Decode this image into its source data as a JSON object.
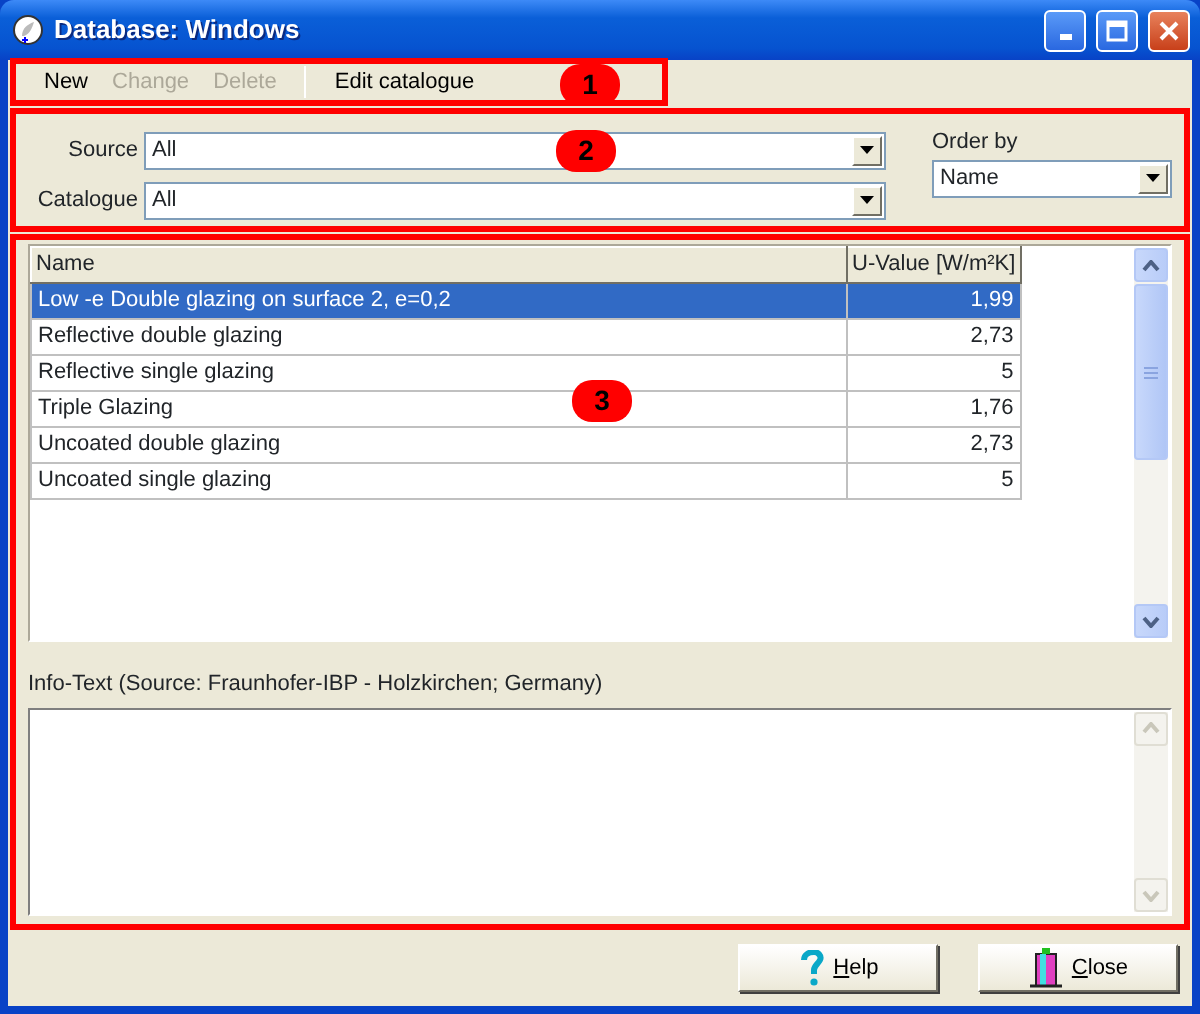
{
  "window": {
    "title": "Database: Windows"
  },
  "toolbar": {
    "callout": "1",
    "items": [
      {
        "kind": "button",
        "label": "New",
        "disabled": false
      },
      {
        "kind": "button",
        "label": "Change",
        "disabled": true
      },
      {
        "kind": "button",
        "label": "Delete",
        "disabled": true
      },
      {
        "kind": "separator"
      },
      {
        "kind": "button",
        "label": "Edit catalogue",
        "disabled": false
      }
    ]
  },
  "filters": {
    "callout": "2",
    "source": {
      "label": "Source",
      "value": "All"
    },
    "catalogue": {
      "label": "Catalogue",
      "value": "All"
    },
    "order_by": {
      "label": "Order by",
      "value": "Name"
    }
  },
  "table": {
    "callout": "3",
    "columns": [
      "Name",
      "U-Value [W/m²K]"
    ],
    "rows": [
      {
        "cells": [
          "Low -e Double glazing on surface 2, e=0,2",
          "1,99"
        ],
        "selected": true
      },
      {
        "cells": [
          "Reflective double glazing",
          "2,73"
        ],
        "selected": false
      },
      {
        "cells": [
          "Reflective single glazing",
          "5"
        ],
        "selected": false
      },
      {
        "cells": [
          "Triple Glazing",
          "1,76"
        ],
        "selected": false
      },
      {
        "cells": [
          "Uncoated double glazing",
          "2,73"
        ],
        "selected": false
      },
      {
        "cells": [
          "Uncoated single glazing",
          "5"
        ],
        "selected": false
      }
    ]
  },
  "info": {
    "label": "Info-Text  (Source: Fraunhofer-IBP - Holzkirchen; Germany)"
  },
  "buttons": [
    {
      "kind": "help",
      "label": "Help"
    },
    {
      "kind": "close",
      "label": "Close"
    }
  ]
}
